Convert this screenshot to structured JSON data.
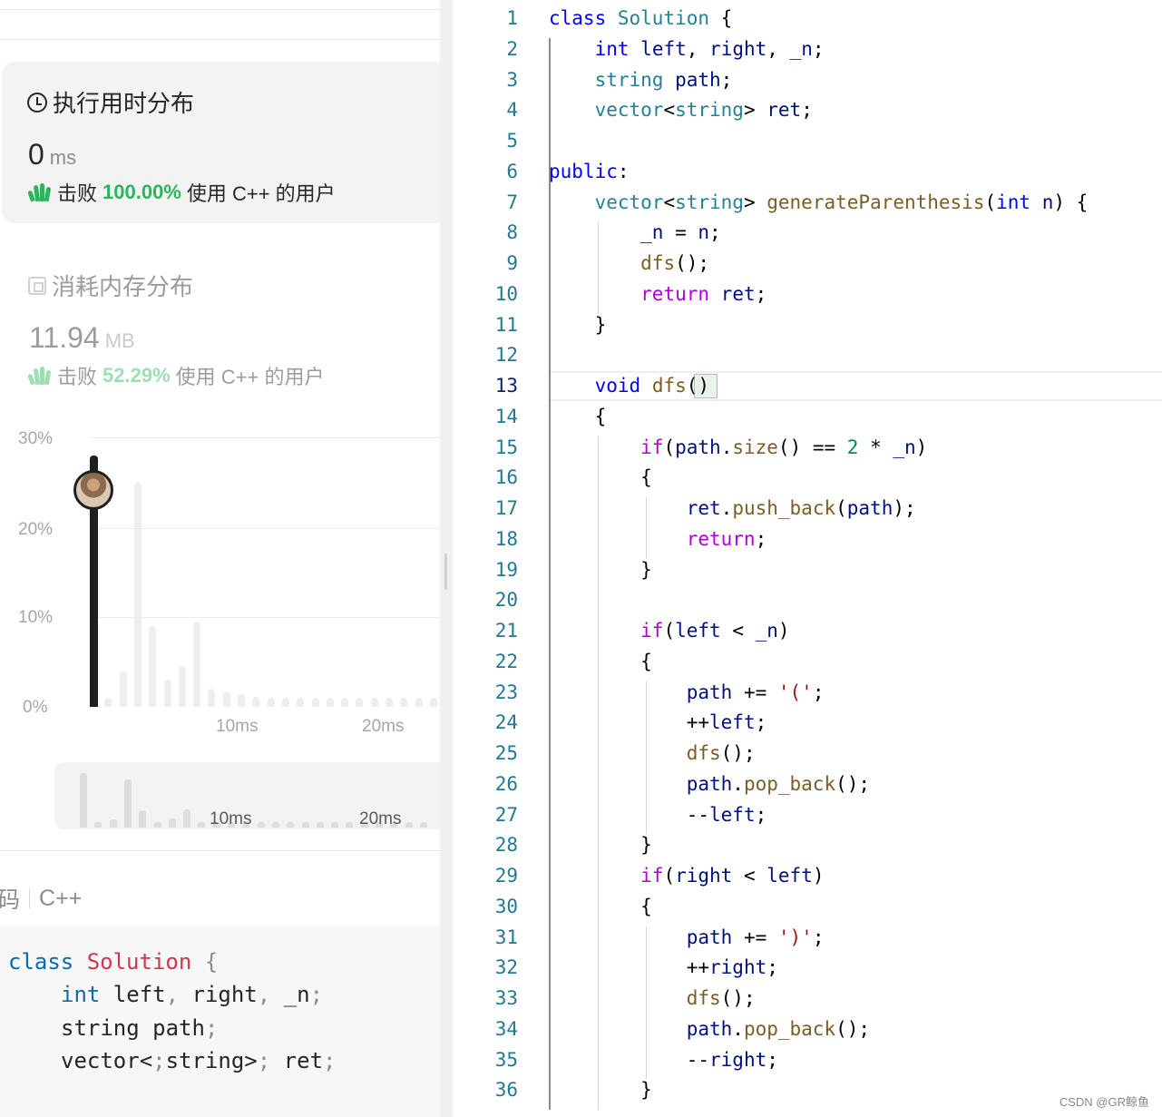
{
  "runtime": {
    "title": "执行用时分布",
    "value": "0",
    "unit": "ms",
    "beat_prefix": "击败",
    "beat_pct": "100.00%",
    "beat_suffix": "使用 C++ 的用户"
  },
  "memory": {
    "title": "消耗内存分布",
    "value": "11.94",
    "unit": "MB",
    "beat_prefix": "击败",
    "beat_pct": "52.29%",
    "beat_suffix": "使用 C++ 的用户"
  },
  "chart_data": {
    "type": "bar",
    "title": "",
    "xlabel": "",
    "ylabel": "",
    "ylim": [
      0,
      30
    ],
    "y_ticks": [
      "30%",
      "20%",
      "10%",
      "0%"
    ],
    "x_ticks": [
      "10ms",
      "20ms"
    ],
    "x": [
      0,
      1,
      2,
      3,
      4,
      5,
      6,
      7,
      8,
      9,
      10,
      11,
      12,
      13,
      14,
      15,
      16,
      17,
      18,
      19,
      20,
      21,
      22,
      23
    ],
    "values": [
      28,
      1,
      4,
      25,
      9,
      3,
      4.5,
      9.5,
      2,
      1.6,
      1.4,
      1.1,
      1.0,
      1.0,
      1.0,
      1.0,
      1.0,
      1.0,
      1.0,
      1.0,
      1.0,
      1.0,
      1.0,
      1.0
    ],
    "highlight_index": 0,
    "mini_x_ticks": [
      "10ms",
      "20ms"
    ]
  },
  "code_section": {
    "label_partial": "代码",
    "language": "C++",
    "preview": [
      "class Solution {",
      "int left, right, _n;",
      "string path;",
      "vector<string> ret;"
    ]
  },
  "editor": {
    "current_line": 13,
    "lines": [
      "class Solution {",
      "    int left, right, _n;",
      "    string path;",
      "    vector<string> ret;",
      "",
      "public:",
      "    vector<string> generateParenthesis(int n) {",
      "        _n = n;",
      "        dfs();",
      "        return ret;",
      "    }",
      "",
      "    void dfs()",
      "    {",
      "        if(path.size() == 2 * _n)",
      "        {",
      "            ret.push_back(path);",
      "            return;",
      "        }",
      "",
      "        if(left < _n)",
      "        {",
      "            path += '(';",
      "            ++left;",
      "            dfs();",
      "            path.pop_back();",
      "            --left;",
      "        }",
      "        if(right < left)",
      "        {",
      "            path += ')';",
      "            ++right;",
      "            dfs();",
      "            path.pop_back();",
      "            --right;",
      "        }"
    ]
  },
  "watermark": "CSDN @GR鲸鱼",
  "colors": {
    "beat_green": "#2db55d",
    "chart_bar": "#eeeeee",
    "highlight_bar": "#1f1f1f"
  }
}
